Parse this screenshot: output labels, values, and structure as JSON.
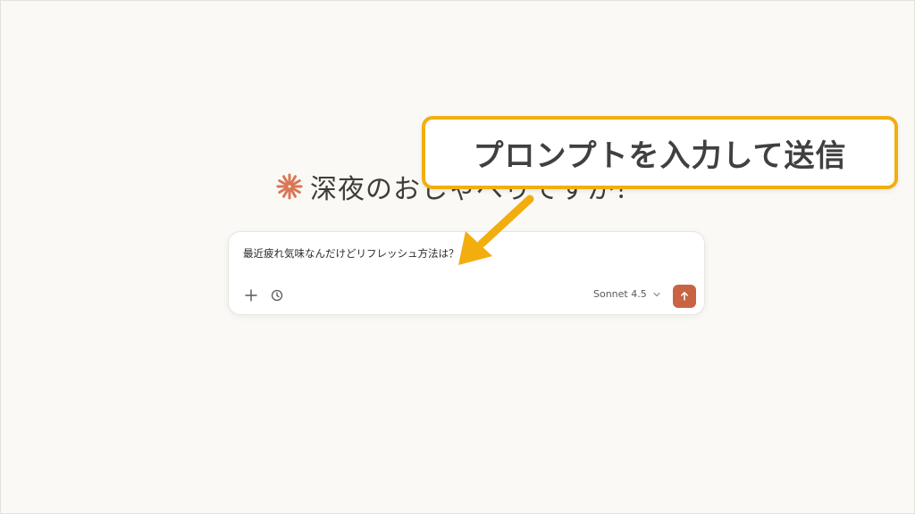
{
  "greeting": {
    "text": "深夜のおしゃべりですか？",
    "logo_icon": "claude-asterisk-icon",
    "logo_color": "#d97757"
  },
  "composer": {
    "prompt_value": "最近疲れ気味なんだけどリフレッシュ方法は？",
    "add_icon": "plus-icon",
    "history_icon": "clock-icon",
    "model_label": "Sonnet 4.5",
    "model_icon": "chevron-down-icon",
    "send_icon": "arrow-up-icon",
    "send_color": "#c96442"
  },
  "annotation": {
    "callout_text": "プロンプトを入力して送信",
    "border_color": "#f2ae0f",
    "arrow_color": "#f2ae0f"
  }
}
